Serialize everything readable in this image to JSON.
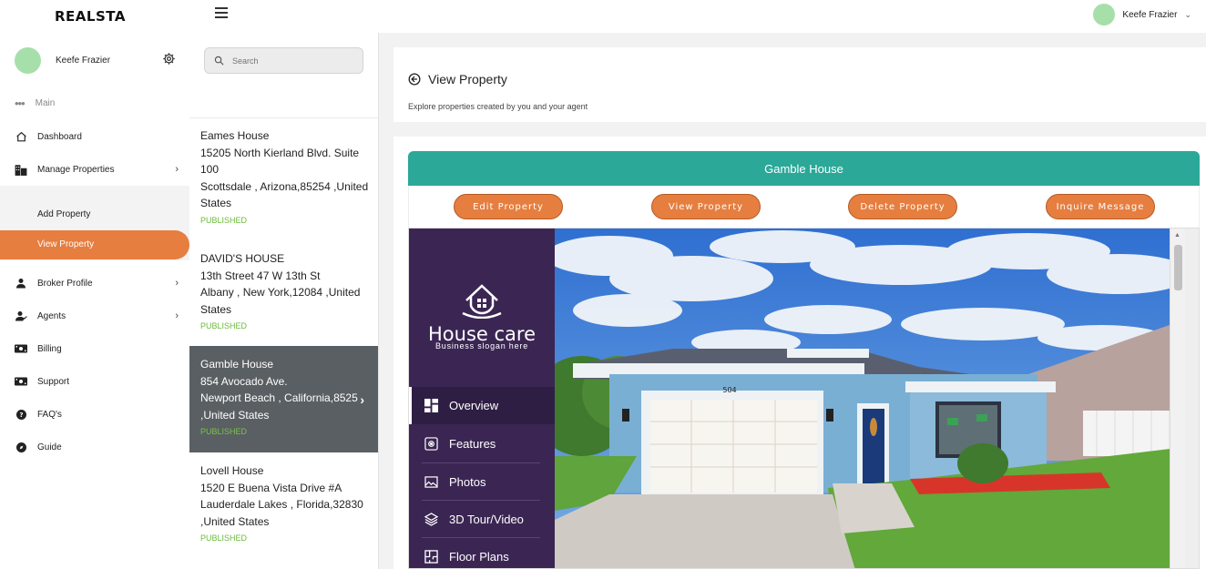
{
  "app": {
    "logo": "REALSTA"
  },
  "topbar": {
    "user_name": "Keefe Frazier"
  },
  "sidebar": {
    "user_name": "Keefe Frazier",
    "section": "Main",
    "items": [
      {
        "label": "Dashboard",
        "icon": "home-icon"
      },
      {
        "label": "Manage Properties",
        "icon": "building-icon"
      },
      {
        "label": "Broker Profile",
        "icon": "user-icon"
      },
      {
        "label": "Agents",
        "icon": "agents-icon"
      },
      {
        "label": "Billing",
        "icon": "billing-icon"
      },
      {
        "label": "Support",
        "icon": "support-icon"
      },
      {
        "label": "FAQ's",
        "icon": "question-icon"
      },
      {
        "label": "Guide",
        "icon": "compass-icon"
      }
    ],
    "submenu": [
      {
        "label": "Add Property"
      },
      {
        "label": "View Property"
      }
    ]
  },
  "search": {
    "placeholder": "Search"
  },
  "properties": [
    {
      "name": "Eames House",
      "line1": "15205 North Kierland Blvd. Suite",
      "line2": "100",
      "line3": "Scottsdale , Arizona,85254 ,United",
      "line4": "States",
      "status": "PUBLISHED"
    },
    {
      "name": "DAVID'S HOUSE",
      "line1": "13th Street 47 W 13th St",
      "line2": "Albany , New York,12084 ,United",
      "line3": "States",
      "status": "PUBLISHED"
    },
    {
      "name": "Gamble House",
      "line1": "854 Avocado Ave.",
      "line2": "Newport Beach , California,8525",
      "line3": ",United States",
      "status": "PUBLISHED"
    },
    {
      "name": "Lovell House",
      "line1": "1520 E Buena Vista Drive #A",
      "line2": "Lauderdale Lakes , Florida,32830",
      "line3": ",United States",
      "status": "PUBLISHED"
    }
  ],
  "page": {
    "title": "View Property",
    "subtitle": "Explore properties created by you and your agent"
  },
  "property": {
    "name": "Gamble House",
    "accent_color": "#2ba898",
    "button_color": "#e67e3f",
    "buttons": {
      "edit": "Edit Property",
      "view": "View Property",
      "delete": "Delete Property",
      "inquire": "Inquire Message"
    }
  },
  "viewer": {
    "brand_name": "House care",
    "brand_slogan": "Business slogan here",
    "house_number": "504",
    "nav": [
      {
        "label": "Overview",
        "icon": "grid-icon"
      },
      {
        "label": "Features",
        "icon": "features-icon"
      },
      {
        "label": "Photos",
        "icon": "photo-icon"
      },
      {
        "label": "3D Tour/Video",
        "icon": "layers-icon"
      },
      {
        "label": "Floor Plans",
        "icon": "floorplan-icon"
      }
    ]
  }
}
